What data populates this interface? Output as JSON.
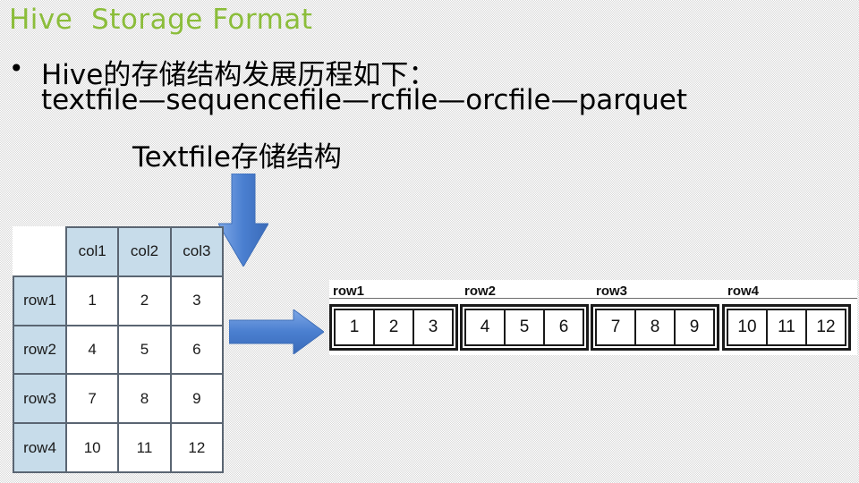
{
  "slide": {
    "title": "Hive  Storage Format",
    "bullet_symbol": "•",
    "line1": "Hive的存储结构发展历程如下：",
    "line2": "textfile—sequencefile—rcfile—orcfile—parquet",
    "sub_caption": "Textfile存储结构",
    "title_color": "#8bbd3a",
    "arrow_color": "#4f86d4"
  },
  "grid": {
    "columns": [
      "col1",
      "col2",
      "col3"
    ],
    "rows": [
      {
        "label": "row1",
        "values": [
          "1",
          "2",
          "3"
        ]
      },
      {
        "label": "row2",
        "values": [
          "4",
          "5",
          "6"
        ]
      },
      {
        "label": "row3",
        "values": [
          "7",
          "8",
          "9"
        ]
      },
      {
        "label": "row4",
        "values": [
          "10",
          "11",
          "12"
        ]
      }
    ],
    "header_color": "#c7dcea"
  },
  "linear": {
    "groups": [
      {
        "label": "row1",
        "values": [
          "1",
          "2",
          "3"
        ]
      },
      {
        "label": "row2",
        "values": [
          "4",
          "5",
          "6"
        ]
      },
      {
        "label": "row3",
        "values": [
          "7",
          "8",
          "9"
        ]
      },
      {
        "label": "row4",
        "values": [
          "10",
          "11",
          "12"
        ]
      }
    ]
  },
  "icons": {
    "down_arrow": "arrow-down-icon",
    "right_arrow": "arrow-right-icon"
  }
}
